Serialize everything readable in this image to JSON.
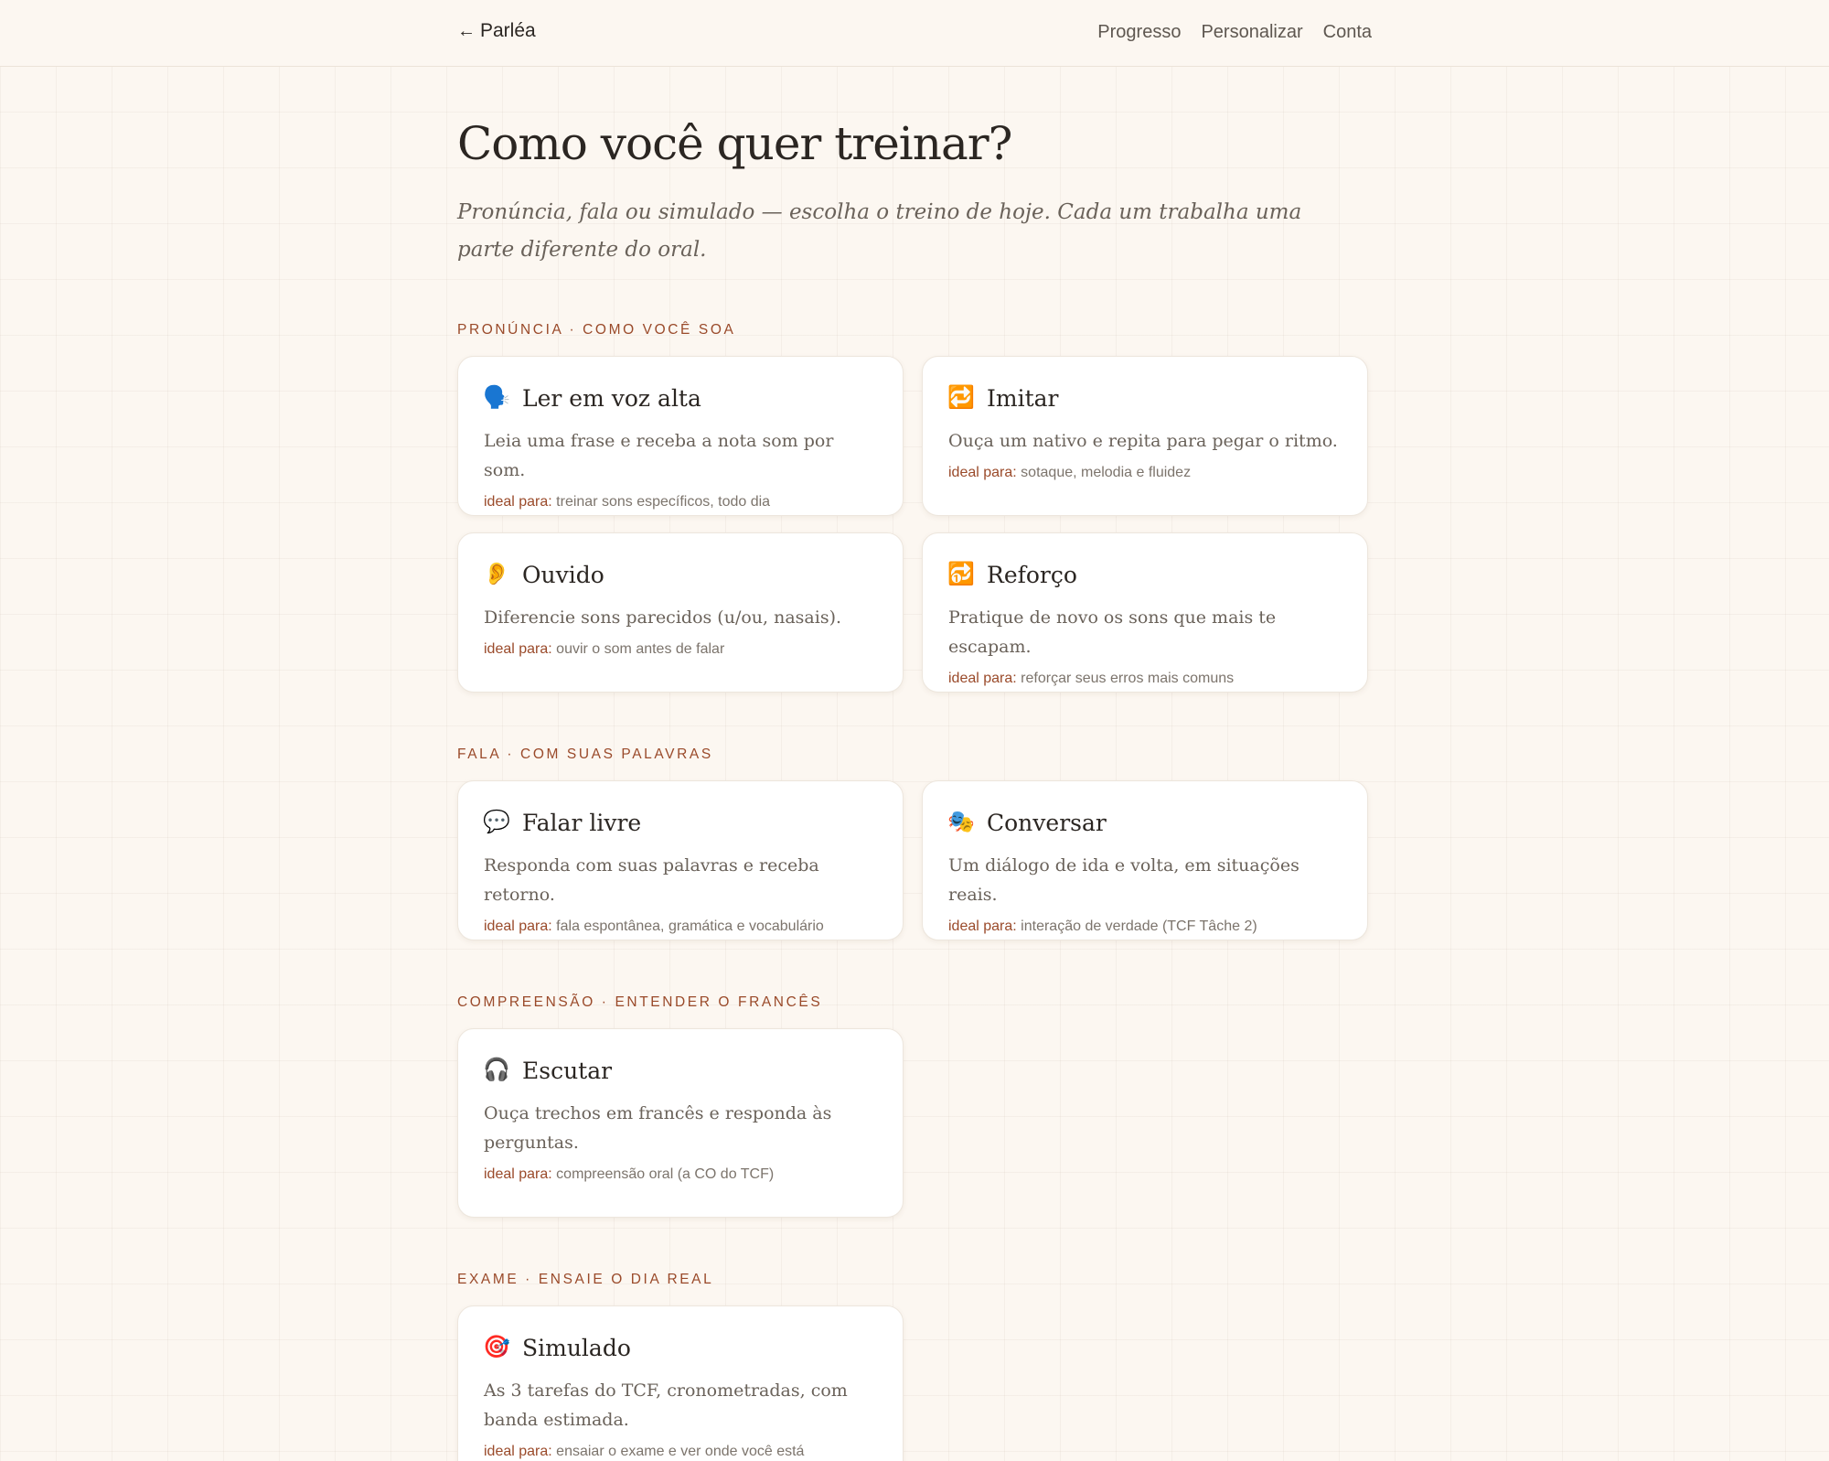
{
  "header": {
    "back_arrow": "←",
    "brand": "Parléa",
    "nav": [
      "Progresso",
      "Personalizar",
      "Conta"
    ]
  },
  "main": {
    "title": "Como você quer treinar?",
    "subtitle": "Pronúncia, fala ou simulado — escolha o treino de hoje. Cada um trabalha uma parte diferente do oral.",
    "ideal_prefix": "ideal para:",
    "sections": [
      {
        "label": "Pronúncia · como você soa",
        "cards": [
          {
            "icon": "🗣️",
            "icon_name": "speaking-head-icon",
            "title": "Ler em voz alta",
            "desc": "Leia uma frase e receba a nota som por som.",
            "ideal": "treinar sons específicos, todo dia"
          },
          {
            "icon": "🔁",
            "icon_name": "repeat-icon",
            "title": "Imitar",
            "desc": "Ouça um nativo e repita para pegar o ritmo.",
            "ideal": "sotaque, melodia e fluidez"
          },
          {
            "icon": "👂",
            "icon_name": "ear-icon",
            "title": "Ouvido",
            "desc": "Diferencie sons parecidos (u/ou, nasais).",
            "ideal": "ouvir o som antes de falar"
          },
          {
            "icon": "🔂",
            "icon_name": "repeat-single-icon",
            "title": "Reforço",
            "desc": "Pratique de novo os sons que mais te escapam.",
            "ideal": "reforçar seus erros mais comuns"
          }
        ]
      },
      {
        "label": "Fala · com suas palavras",
        "cards": [
          {
            "icon": "💬",
            "icon_name": "speech-bubble-icon",
            "title": "Falar livre",
            "desc": "Responda com suas palavras e receba retorno.",
            "ideal": "fala espontânea, gramática e vocabulário"
          },
          {
            "icon": "🎭",
            "icon_name": "theater-masks-icon",
            "title": "Conversar",
            "desc": "Um diálogo de ida e volta, em situações reais.",
            "ideal": "interação de verdade (TCF Tâche 2)"
          }
        ]
      },
      {
        "label": "Compreensão · entender o francês",
        "cards": [
          {
            "icon": "🎧",
            "icon_name": "headphones-icon",
            "title": "Escutar",
            "desc": "Ouça trechos em francês e responda às perguntas.",
            "ideal": "compreensão oral (a CO do TCF)"
          }
        ]
      },
      {
        "label": "Exame · ensaie o dia real",
        "cards": [
          {
            "icon": "🎯",
            "icon_name": "target-icon",
            "title": "Simulado",
            "desc": "As 3 tarefas do TCF, cronometradas, com banda estimada.",
            "ideal": "ensaiar o exame e ver onde você está"
          }
        ]
      }
    ]
  }
}
